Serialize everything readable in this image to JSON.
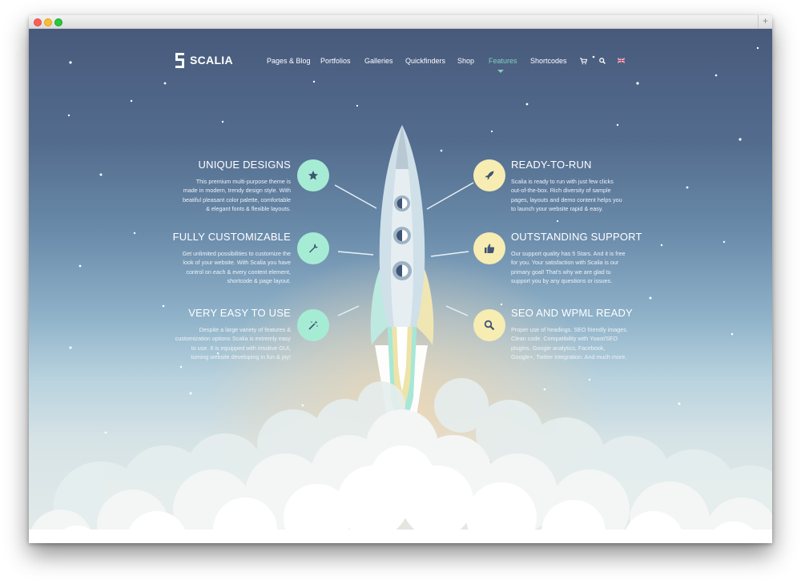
{
  "browser": {
    "new_tab_symbol": "+"
  },
  "header": {
    "logo_text": "SCALIA",
    "nav": [
      {
        "label": "Pages & Blog",
        "active": false
      },
      {
        "label": "Portfolios",
        "active": false
      },
      {
        "label": "Galleries",
        "active": false
      },
      {
        "label": "Quickfinders",
        "active": false
      },
      {
        "label": "Shop",
        "active": false
      },
      {
        "label": "Features",
        "active": true
      },
      {
        "label": "Shortcodes",
        "active": false
      }
    ],
    "icons": [
      "cart-icon",
      "search-icon",
      "uk-flag-icon"
    ]
  },
  "features": {
    "left": [
      {
        "title": "UNIQUE DESIGNS",
        "icon": "star-icon",
        "lines": [
          "This premium multi-purpose theme is",
          "made in modern, trendy design style. With",
          "beatiful pleasant color palette, comfortable",
          "& elegant fonts & flexible layouts."
        ]
      },
      {
        "title": "FULLY CUSTOMIZABLE",
        "icon": "wrench-icon",
        "lines": [
          "Get unlimited possibilities to customize the",
          "look of your website. With Scalia you have",
          "control on each & every content element,",
          "shortcode & page layout."
        ]
      },
      {
        "title": "VERY EASY TO USE",
        "icon": "magic-wand-icon",
        "lines": [
          "Despite a large variety of features &",
          "customization options Scalia is extremly easy",
          "to use. It is equipped with intuitive GUI,",
          "turning website developing in fun & joy!"
        ]
      }
    ],
    "right": [
      {
        "title": "READY-TO-RUN",
        "icon": "rocket-icon",
        "lines": [
          "Scalia is ready to run with just few clicks",
          "out-of-the-box. Rich diversity of sample",
          "pages, layouts and demo content helps you",
          "to launch your website rapid & easy."
        ]
      },
      {
        "title": "OUTSTANDING SUPPORT",
        "icon": "thumbs-up-icon",
        "lines": [
          "Our support quality has 5 Stars. And it is free",
          "for you. Your satisfaction with Scalia is our",
          "primary goal! That's why we are glad tu",
          "support you by any questions or issues."
        ]
      },
      {
        "title": "SEO AND WPML READY",
        "icon": "magnifier-icon",
        "lines": [
          "Proper use of headings. SEO friendly images.",
          "Clean code. Compatibility with Yoast/SEO",
          "plugins. Google analytics, Facebook,",
          "Google+, Twitter integration. And much more."
        ]
      }
    ]
  },
  "colors": {
    "accent_mint": "#a6ecd4",
    "accent_cream": "#f7ecb2",
    "active_nav": "#7fd1c4"
  }
}
